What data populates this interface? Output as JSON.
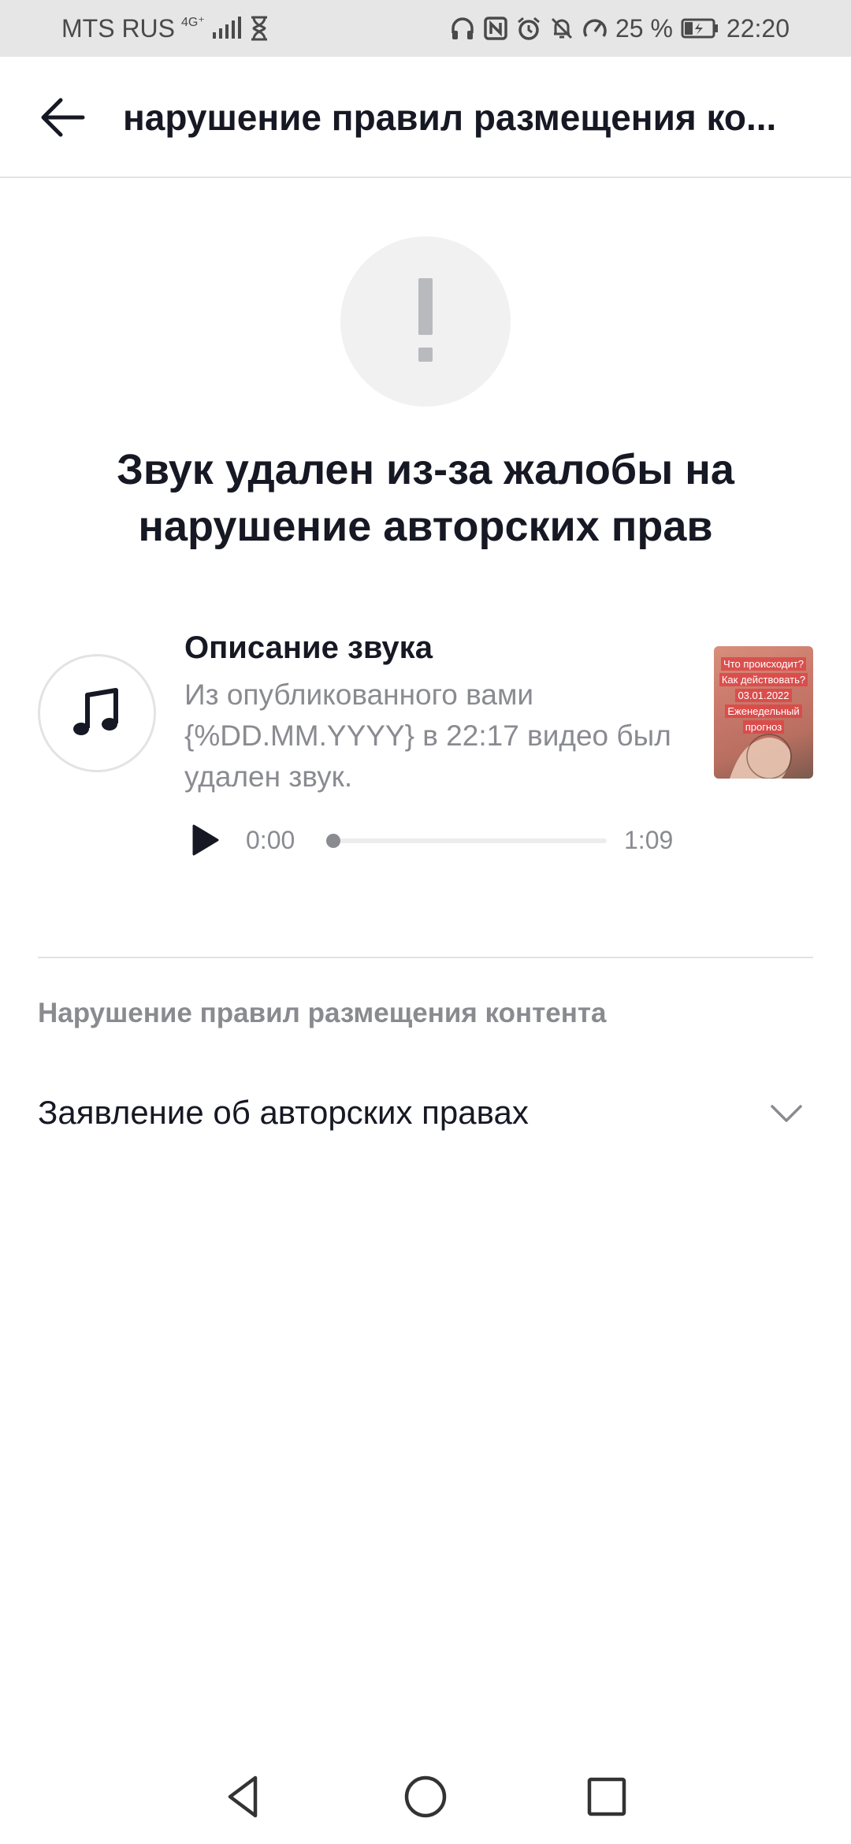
{
  "status_bar": {
    "carrier": "MTS RUS",
    "network": "4G⁺",
    "battery_percent": "25 %",
    "time": "22:20"
  },
  "header": {
    "title": "нарушение правил размещения ко..."
  },
  "notice": {
    "title": "Звук удален из-за жалобы на нарушение авторских прав"
  },
  "sound": {
    "title": "Описание звука",
    "description": "Из опубликованного вами {%DD.MM.YYYY} в 22:17 видео был удален звук.",
    "thumbnail_lines": [
      "Что происходит?",
      "Как действовать?",
      "03.01.2022",
      "Еженедельный",
      "прогноз"
    ],
    "player": {
      "current_time": "0:00",
      "duration": "1:09",
      "progress": 0
    }
  },
  "violation": {
    "section_label": "Нарушение правил размещения контента",
    "claim_label": "Заявление об авторских правах"
  },
  "colors": {
    "primary_text": "#161823",
    "secondary_text": "#8a8b91",
    "divider": "#e3e3e4",
    "status_bar_bg": "#e6e6e6"
  }
}
